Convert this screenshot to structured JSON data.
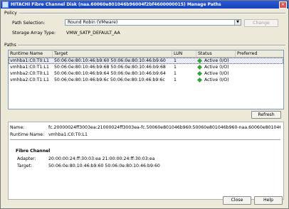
{
  "window": {
    "title": "HITACHI Fibre Channel Disk (naa.60060e801046b96004f2bf4600000015) Manage Paths"
  },
  "policy": {
    "group_label": "Policy",
    "path_selection_label": "Path Selection:",
    "path_selection_value": "Round Robin (VMware)",
    "change_button": "Change",
    "storage_array_type_label": "Storage Array Type:",
    "storage_array_type_value": "VMW_SATP_DEFAULT_AA"
  },
  "paths": {
    "group_label": "Paths",
    "columns": [
      "Runtime Name",
      "Target",
      "LUN",
      "Status",
      "Preferred"
    ],
    "rows": [
      {
        "runtime": "vmhba1:C0:T0:L1",
        "target": "50:06:0e:80:10:46:b9:60 50:06:0e:80:10:46:b9:60",
        "lun": "1",
        "status": "Active (I/O)",
        "preferred": ""
      },
      {
        "runtime": "vmhba1:C0:T1:L1",
        "target": "50:06:0e:80:10:46:b9:68 50:06:0e:80:10:46:b9:68",
        "lun": "1",
        "status": "Active (I/O)",
        "preferred": ""
      },
      {
        "runtime": "vmhba2:C0:T0:L1",
        "target": "50:06:0e:80:10:46:b9:64 50:06:0e:80:10:46:b9:64",
        "lun": "1",
        "status": "Active (I/O)",
        "preferred": ""
      },
      {
        "runtime": "vmhba2:C0:T1:L1",
        "target": "50:06:0e:80:10:46:b9:6c 50:06:0e:80:10:46:b9:6c",
        "lun": "1",
        "status": "Active (I/O)",
        "preferred": ""
      }
    ],
    "refresh_button": "Refresh"
  },
  "details": {
    "name_label": "Name:",
    "name_value": "fc.20000024ff3003ea:21000024ff3003ea-fc.50060e801046b960:50060e801046b960-naa.60060e801046b96004f2b...",
    "runtime_label": "Runtime Name:",
    "runtime_value": "vmhba1:C0:T0:L1",
    "fc_title": "Fibre Channel",
    "adapter_label": "Adapter:",
    "adapter_value": "20:00:00:24:ff:30:03:ea 21:00:00:24:ff:30:03:ea",
    "target_label": "Target:",
    "target_value": "50:06:0e:80:10:46:b9:60 50:06:0e:80:10:46:b9:60"
  },
  "footer": {
    "close_button": "Close",
    "help_button": "Help"
  },
  "colors": {
    "title_bar": "#1f4fc8",
    "status_active": "#3aa23a"
  }
}
